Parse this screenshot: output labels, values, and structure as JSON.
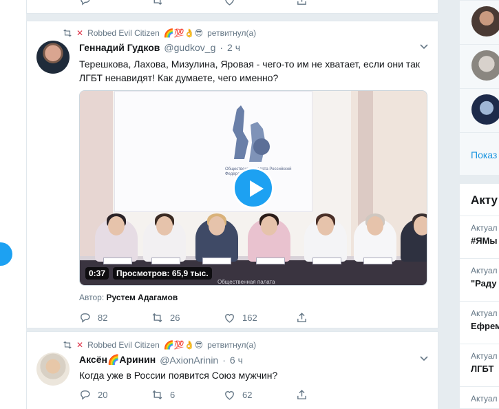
{
  "colors": {
    "accent": "#1da1f2",
    "muted": "#657786",
    "text": "#14171a",
    "background": "#e6ecf0",
    "retweet_x": "#dd2e44"
  },
  "previous_tweet": {
    "actions_visible": [
      "reply-icon",
      "retweet-icon",
      "like-icon",
      "share-icon"
    ]
  },
  "tweets": [
    {
      "retweeter": "Robbed Evil Citizen",
      "retweeter_emojis": "🌈💯👌😎",
      "retweet_suffix": "ретвитнул(а)",
      "name": "Геннадий Гудков",
      "handle": "@gudkov_g",
      "separator": "·",
      "time": "2 ч",
      "text": "Терешкова, Лахова, Мизулина, Яровая - чего-то им не хватает, если они так ЛГБТ ненавидят! Как думаете, чего именно?",
      "video": {
        "duration": "0:37",
        "views": "Просмотров: 65,9 тыс.",
        "caption": "Общественная палата",
        "banner_text": "Общественная палата Российской Федерации"
      },
      "author_label": "Автор:",
      "author_name": "Рустем Адагамов",
      "replies": "82",
      "retweets": "26",
      "likes": "162"
    },
    {
      "retweeter": "Robbed Evil Citizen",
      "retweeter_emojis": "🌈💯👌😎",
      "retweet_suffix": "ретвитнул(а)",
      "name": "Аксён🌈Аринин",
      "handle": "@AxionArinin",
      "separator": "·",
      "time": "6 ч",
      "text": "Когда уже в России появится Союз мужчин?",
      "replies": "20",
      "retweets": "6",
      "likes": "62"
    }
  ],
  "sidebar": {
    "show_more": "Показ",
    "trends_title": "Акту",
    "trends": [
      {
        "label": "Актуал",
        "name": "#ЯМы"
      },
      {
        "label": "Актуал",
        "name": "\"Раду"
      },
      {
        "label": "Актуал",
        "name": "Ефрем"
      },
      {
        "label": "Актуал",
        "name": "ЛГБТ"
      },
      {
        "label": "Актуал",
        "name": ""
      }
    ]
  }
}
